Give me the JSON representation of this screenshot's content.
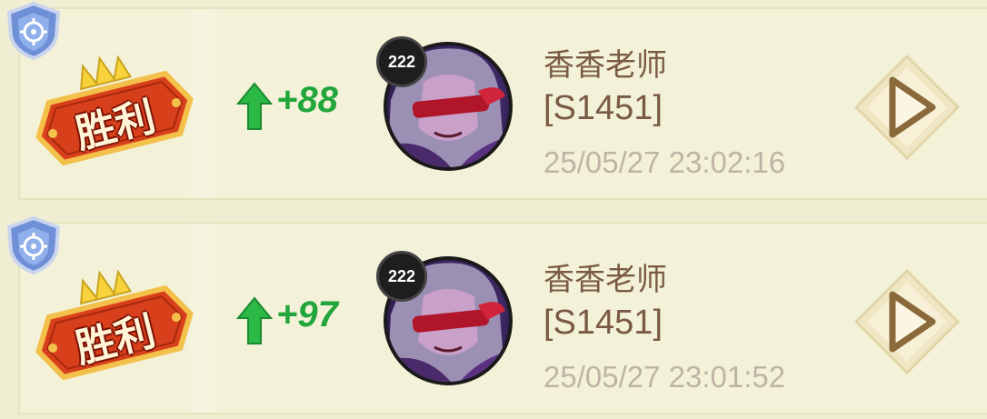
{
  "records": [
    {
      "result": "胜利",
      "score_change": "+88",
      "level": "222",
      "player_name": "香香老师",
      "server": "[S1451]",
      "timestamp": "25/05/27 23:02:16"
    },
    {
      "result": "胜利",
      "score_change": "+97",
      "level": "222",
      "player_name": "香香老师",
      "server": "[S1451]",
      "timestamp": "25/05/27 23:01:52"
    }
  ],
  "colors": {
    "row_bg": "#f3f2d8",
    "victory_red": "#d8401c",
    "score_green": "#22a63c",
    "name_brown": "#7a5a44",
    "time_grey": "#bfb3a6"
  },
  "icons": [
    "shield-icon",
    "victory-banner-icon",
    "up-arrow-icon",
    "play-replay-icon"
  ]
}
